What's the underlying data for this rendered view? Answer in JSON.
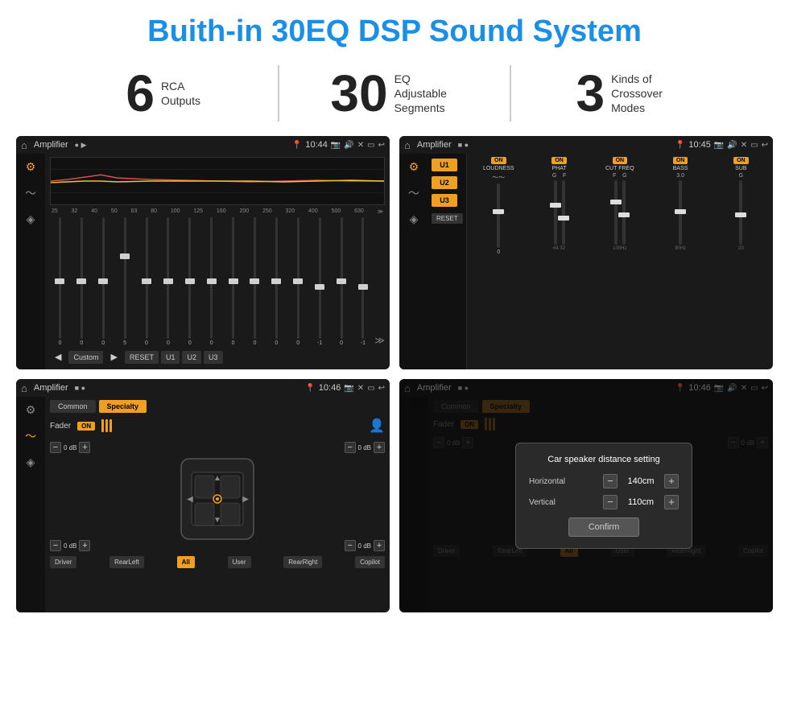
{
  "page": {
    "title": "Buith-in 30EQ DSP Sound System",
    "stats": [
      {
        "number": "6",
        "label": "RCA\nOutputs"
      },
      {
        "number": "30",
        "label": "EQ Adjustable\nSegments"
      },
      {
        "number": "3",
        "label": "Kinds of\nCrossover Modes"
      }
    ]
  },
  "screens": {
    "eq": {
      "title": "Amplifier",
      "time": "10:44",
      "frequencies": [
        "25",
        "32",
        "40",
        "50",
        "63",
        "80",
        "100",
        "125",
        "160",
        "200",
        "250",
        "320",
        "400",
        "500",
        "630"
      ],
      "values": [
        "0",
        "0",
        "0",
        "5",
        "0",
        "0",
        "0",
        "0",
        "0",
        "0",
        "0",
        "0",
        "-1",
        "0",
        "-1"
      ],
      "preset": "Custom",
      "buttons": [
        "RESET",
        "U1",
        "U2",
        "U3"
      ]
    },
    "crossover": {
      "title": "Amplifier",
      "time": "10:45",
      "presets": [
        "U1",
        "U2",
        "U3"
      ],
      "channels": [
        "LOUDNESS",
        "PHAT",
        "CUT FREQ",
        "BASS",
        "SUB"
      ],
      "reset_label": "RESET"
    },
    "fader": {
      "title": "Amplifier",
      "time": "10:46",
      "tabs": [
        "Common",
        "Specialty"
      ],
      "fader_label": "Fader",
      "on_label": "ON",
      "positions": [
        {
          "label": "Driver"
        },
        {
          "label": "RearLeft"
        },
        {
          "label": "All"
        },
        {
          "label": "RearRight"
        },
        {
          "label": "Copilot"
        },
        {
          "label": "User"
        }
      ],
      "vol_labels": [
        "0 dB",
        "0 dB",
        "0 dB",
        "0 dB"
      ]
    },
    "dialog": {
      "title": "Amplifier",
      "time": "10:46",
      "tabs": [
        "Common",
        "Specialty"
      ],
      "dialog_title": "Car speaker distance setting",
      "fields": [
        {
          "label": "Horizontal",
          "value": "140cm"
        },
        {
          "label": "Vertical",
          "value": "110cm"
        }
      ],
      "confirm_label": "Confirm",
      "positions": [
        {
          "label": "Driver"
        },
        {
          "label": "RearLeft"
        },
        {
          "label": "All"
        },
        {
          "label": "RearRight"
        },
        {
          "label": "Copilot"
        },
        {
          "label": "User"
        }
      ],
      "vol_labels": [
        "0 dB",
        "0 dB"
      ]
    }
  }
}
